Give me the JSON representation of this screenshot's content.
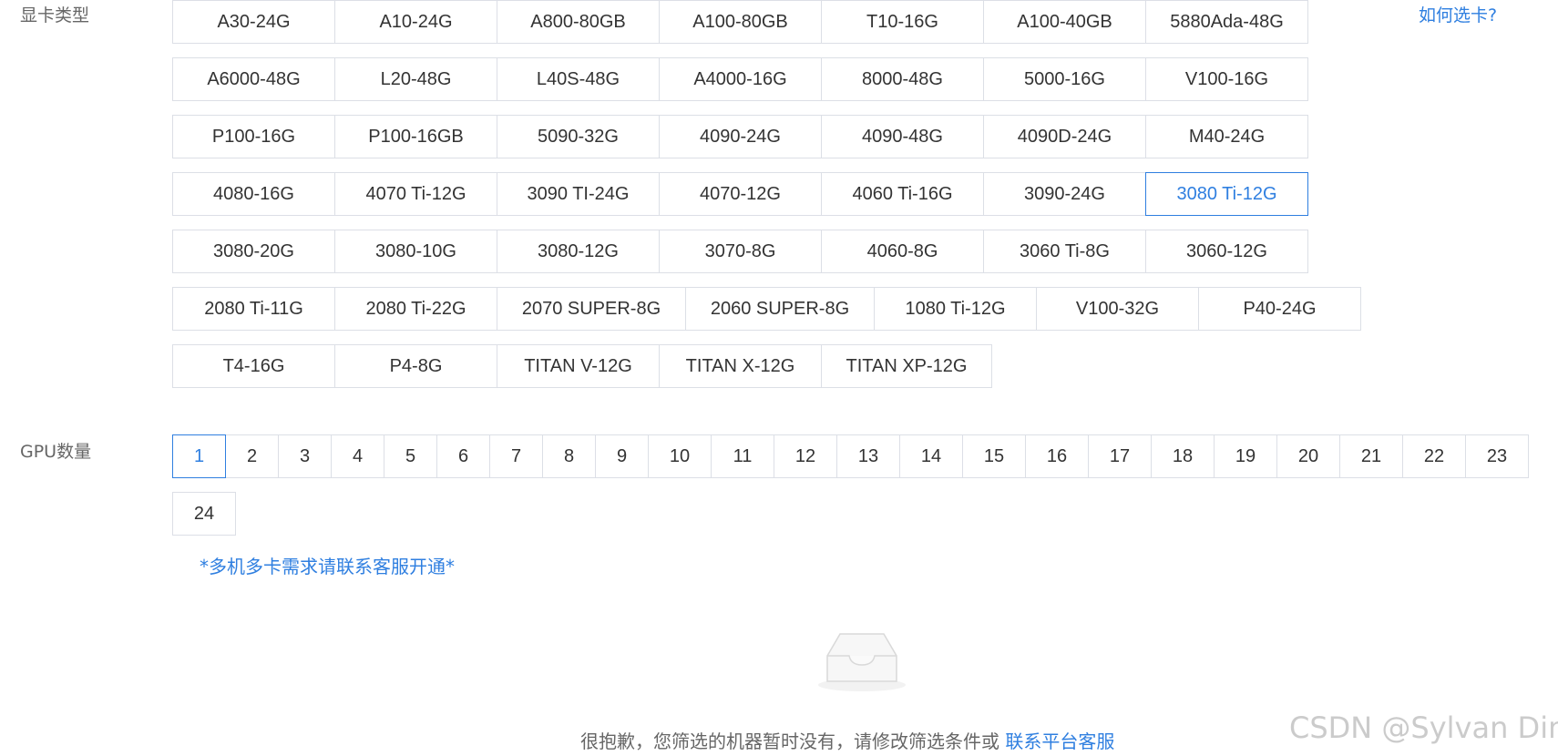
{
  "gpu_type": {
    "label": "显卡类型",
    "help_link": "如何选卡?",
    "rows": [
      [
        "A30-24G",
        "A10-24G",
        "A800-80GB",
        "A100-80GB",
        "T10-16G",
        "A100-40GB",
        "5880Ada-48G"
      ],
      [
        "A6000-48G",
        "L20-48G",
        "L40S-48G",
        "A4000-16G",
        "8000-48G",
        "5000-16G",
        "V100-16G"
      ],
      [
        "P100-16G",
        "P100-16GB",
        "5090-32G",
        "4090-24G",
        "4090-48G",
        "4090D-24G",
        "M40-24G"
      ],
      [
        "4080-16G",
        "4070 Ti-12G",
        "3090 TI-24G",
        "4070-12G",
        "4060 Ti-16G",
        "3090-24G",
        "3080 Ti-12G"
      ],
      [
        "3080-20G",
        "3080-10G",
        "3080-12G",
        "3070-8G",
        "4060-8G",
        "3060 Ti-8G",
        "3060-12G"
      ],
      [
        "2080 Ti-11G",
        "2080 Ti-22G",
        "2070 SUPER-8G",
        "2060 SUPER-8G",
        "1080 Ti-12G",
        "V100-32G",
        "P40-24G"
      ],
      [
        "T4-16G",
        "P4-8G",
        "TITAN V-12G",
        "TITAN X-12G",
        "TITAN XP-12G"
      ]
    ],
    "selected": "3080 Ti-12G"
  },
  "gpu_count": {
    "label": "GPU数量",
    "options": [
      "1",
      "2",
      "3",
      "4",
      "5",
      "6",
      "7",
      "8",
      "9",
      "10",
      "11",
      "12",
      "13",
      "14",
      "15",
      "16",
      "17",
      "18",
      "19",
      "20",
      "21",
      "22",
      "23",
      "24"
    ],
    "selected": "1",
    "note": "*多机多卡需求请联系客服开通*"
  },
  "empty_state": {
    "icon": "empty-inbox-icon",
    "message": "很抱歉，您筛选的机器暂时没有，请修改筛选条件或",
    "contact_link": "联系平台客服"
  },
  "watermark": "CSDN @Sylvan Ding",
  "colors": {
    "accent": "#2f7fe0",
    "border": "#dcdfe6",
    "text": "#333333",
    "muted": "#666666"
  }
}
